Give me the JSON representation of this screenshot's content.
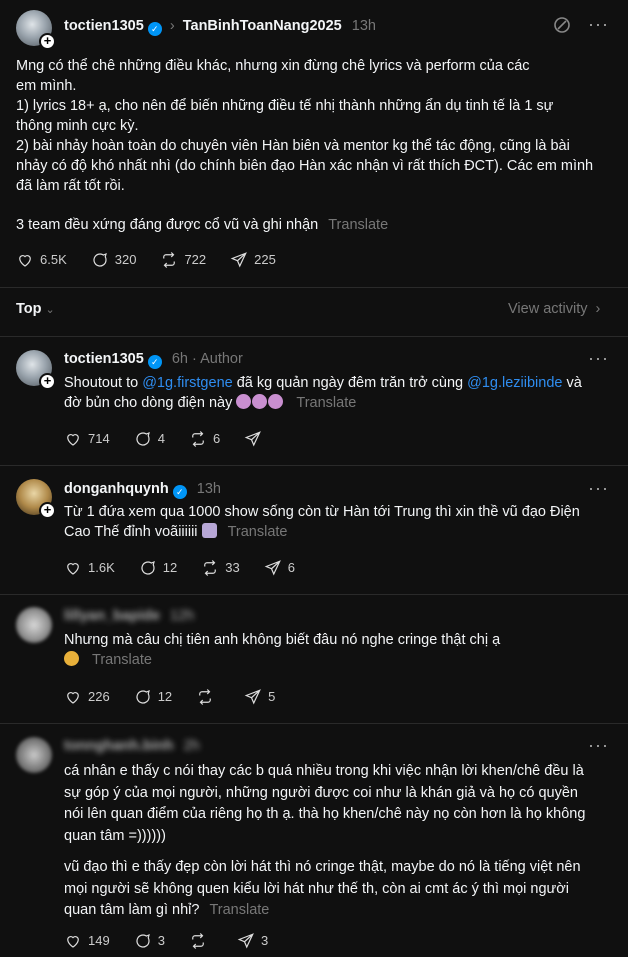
{
  "post": {
    "username": "toctien1305",
    "community": "TanBinhToanNang2025",
    "time": "13h",
    "body": [
      "Mng có thể chê những điều khác, nhưng xin đừng chê lyrics và perform của các",
      "em mình.",
      "1) lyrics 18+ ạ, cho nên để biến những điều tế nhị thành những ẩn dụ tinh tế là 1 sự",
      "thông minh cực kỳ.",
      "2) bài nhảy hoàn toàn do chuyên viên Hàn biên và mentor kg thể tác động, cũng là bài",
      "nhảy có độ khó nhất nhì (do chính biên đạo Hàn xác nhận vì rất thích ĐCT). Các em mình",
      "đã làm rất tốt rồi."
    ],
    "closing": "3 team đều xứng đáng được cổ vũ và ghi nhận",
    "translate": "Translate",
    "likes": "6.5K",
    "comments": "320",
    "reposts": "722",
    "shares": "225"
  },
  "sort": {
    "label": "Top",
    "view_activity": "View activity"
  },
  "replies": [
    {
      "username": "toctien1305",
      "time": "6h",
      "author_tag": "Author",
      "text_pre": "Shoutout to ",
      "mention1": "@1g.firstgene",
      "text_mid": " đã kg quản ngày đêm trăn trở cùng ",
      "mention2": "@1g.leziibinde",
      "text_post": " và",
      "line2": "đờ bủn cho dòng điện này",
      "translate": "Translate",
      "likes": "714",
      "comments": "4",
      "reposts": "6"
    },
    {
      "username": "donganhquynh",
      "time": "13h",
      "line1": "Từ 1 đứa xem qua 1000 show sống còn từ Hàn tới Trung thì xin thề vũ đạo Điện",
      "line2": "Cao Thế đỉnh voãiiiiii",
      "translate": "Translate",
      "likes": "1.6K",
      "comments": "12",
      "reposts": "33",
      "shares": "6"
    },
    {
      "username": "lillyan_bapide",
      "time": "12h",
      "line1": "Nhưng mà câu chị tiên anh không biết đâu nó nghe cringe thật chị ạ",
      "translate": "Translate",
      "likes": "226",
      "comments": "12",
      "shares": "5"
    },
    {
      "username": "tonnghanh.binh",
      "time": "2h",
      "para1": [
        "cá nhân e thấy c nói thay các b quá nhiều trong khi việc nhận lời khen/chê đều là",
        "sự góp ý của mọi người, những người được coi như là khán giả và họ có quyền",
        "nói lên quan điểm của riêng họ th ạ. thà họ khen/chê này nọ còn hơn là họ không",
        "quan tâm =))))))"
      ],
      "para2": [
        "vũ đạo thì e thấy đẹp còn lời hát thì nó cringe thật, maybe do nó là tiếng việt nên",
        "mọi người sẽ không quen kiểu lời hát như thế th, còn ai cmt ác ý thì mọi người",
        "quan tâm làm gì nhỉ?"
      ],
      "translate": "Translate",
      "likes": "149",
      "comments": "3",
      "shares": "3"
    }
  ],
  "icons": [
    "heart-icon",
    "comment-icon",
    "repost-icon",
    "share-icon",
    "more-icon",
    "verified-icon",
    "chevron-right-icon",
    "chevron-down-icon",
    "activity-icon"
  ]
}
